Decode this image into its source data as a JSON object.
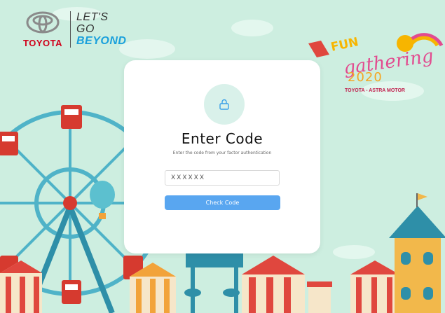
{
  "brand": {
    "name": "TOYOTA",
    "tagline": [
      "LET'S",
      "GO",
      "BEYOND"
    ]
  },
  "event": {
    "line1": "FUN",
    "line2": "gathering",
    "year": "2020",
    "organizer": "TOYOTA - ASTRA MOTOR"
  },
  "card": {
    "icon": "lock-icon",
    "title": "Enter Code",
    "subtitle": "Enter the code from your factor authentication",
    "input_placeholder": "XXXXXX",
    "button_label": "Check Code"
  },
  "colors": {
    "background": "#cdeee0",
    "accent": "#59a6f0",
    "brand_red": "#d0021b",
    "beyond_blue": "#1aa0dc"
  }
}
